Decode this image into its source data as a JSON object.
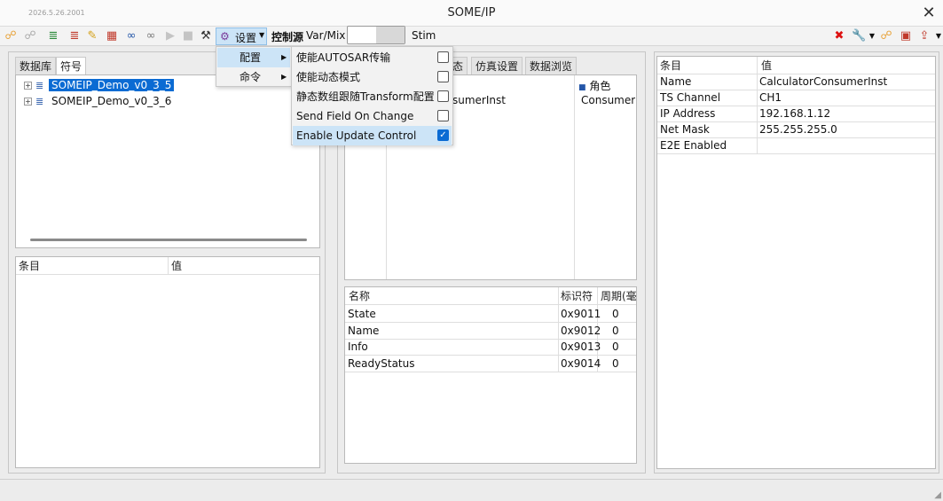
{
  "window": {
    "title": "SOME/IP",
    "build_stamp": "2026.5.26.2001"
  },
  "toolbar": {
    "settings_label": "设置",
    "control_source_label": "控制源",
    "var_mix_label": "Var/Mix",
    "stim_label": "Stim"
  },
  "settings_menu": {
    "items": [
      {
        "label": "配置"
      },
      {
        "label": "命令"
      }
    ]
  },
  "config_submenu": {
    "items": [
      {
        "label": "使能AUTOSAR传输",
        "checked": false
      },
      {
        "label": "使能动态模式",
        "checked": false
      },
      {
        "label": "静态数组跟随Transform配置",
        "checked": false
      },
      {
        "label": "Send Field On Change",
        "checked": false
      },
      {
        "label": "Enable Update Control",
        "checked": true
      }
    ]
  },
  "left_panel": {
    "tabs": [
      {
        "label": "数据库"
      },
      {
        "label": "符号"
      }
    ],
    "tree": [
      {
        "label": "SOMEIP_Demo_v0_3_5",
        "selected": true
      },
      {
        "label": "SOMEIP_Demo_v0_3_6",
        "selected": false
      }
    ],
    "props_header": {
      "item": "条目",
      "value": "值"
    }
  },
  "middle_panel": {
    "tabs": [
      {
        "label": "态"
      },
      {
        "label": "仿真设置"
      },
      {
        "label": "数据浏览"
      }
    ],
    "instance_partial": "sumerInst",
    "role_header": "角色",
    "role_value": "Consumer",
    "table": {
      "headers": {
        "name": "名称",
        "id": "标识符",
        "period": "周期(毫"
      },
      "rows": [
        {
          "name": "State",
          "id": "0x9011",
          "period": "0"
        },
        {
          "name": "Name",
          "id": "0x9012",
          "period": "0"
        },
        {
          "name": "Info",
          "id": "0x9013",
          "period": "0"
        },
        {
          "name": "ReadyStatus",
          "id": "0x9014",
          "period": "0"
        }
      ]
    }
  },
  "right_panel": {
    "header": {
      "item": "条目",
      "value": "值"
    },
    "rows": [
      {
        "item": "Name",
        "value": "CalculatorConsumerInst"
      },
      {
        "item": "TS Channel",
        "value": "CH1"
      },
      {
        "item": "IP Address",
        "value": "192.168.1.12"
      },
      {
        "item": "Net Mask",
        "value": "255.255.255.0"
      },
      {
        "item": "E2E Enabled",
        "value": ""
      }
    ]
  },
  "colors": {
    "selection": "#0b6bd3",
    "menu_highlight": "#cce4f7"
  }
}
